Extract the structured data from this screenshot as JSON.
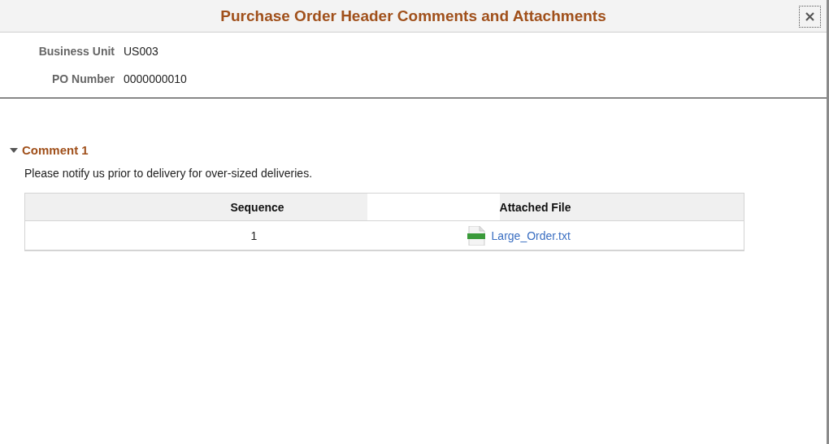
{
  "window": {
    "title": "Purchase Order Header Comments and Attachments"
  },
  "fields": [
    {
      "label": "Business Unit",
      "value": "US003"
    },
    {
      "label": "PO Number",
      "value": "0000000010"
    }
  ],
  "comments": [
    {
      "title": "Comment 1",
      "expanded": true,
      "text": "Please notify us prior to delivery for over-sized deliveries.",
      "table": {
        "columns": [
          "Sequence",
          "Attached File"
        ],
        "rows": [
          {
            "sequence": "1",
            "file": "Large_Order.txt"
          }
        ]
      }
    }
  ]
}
